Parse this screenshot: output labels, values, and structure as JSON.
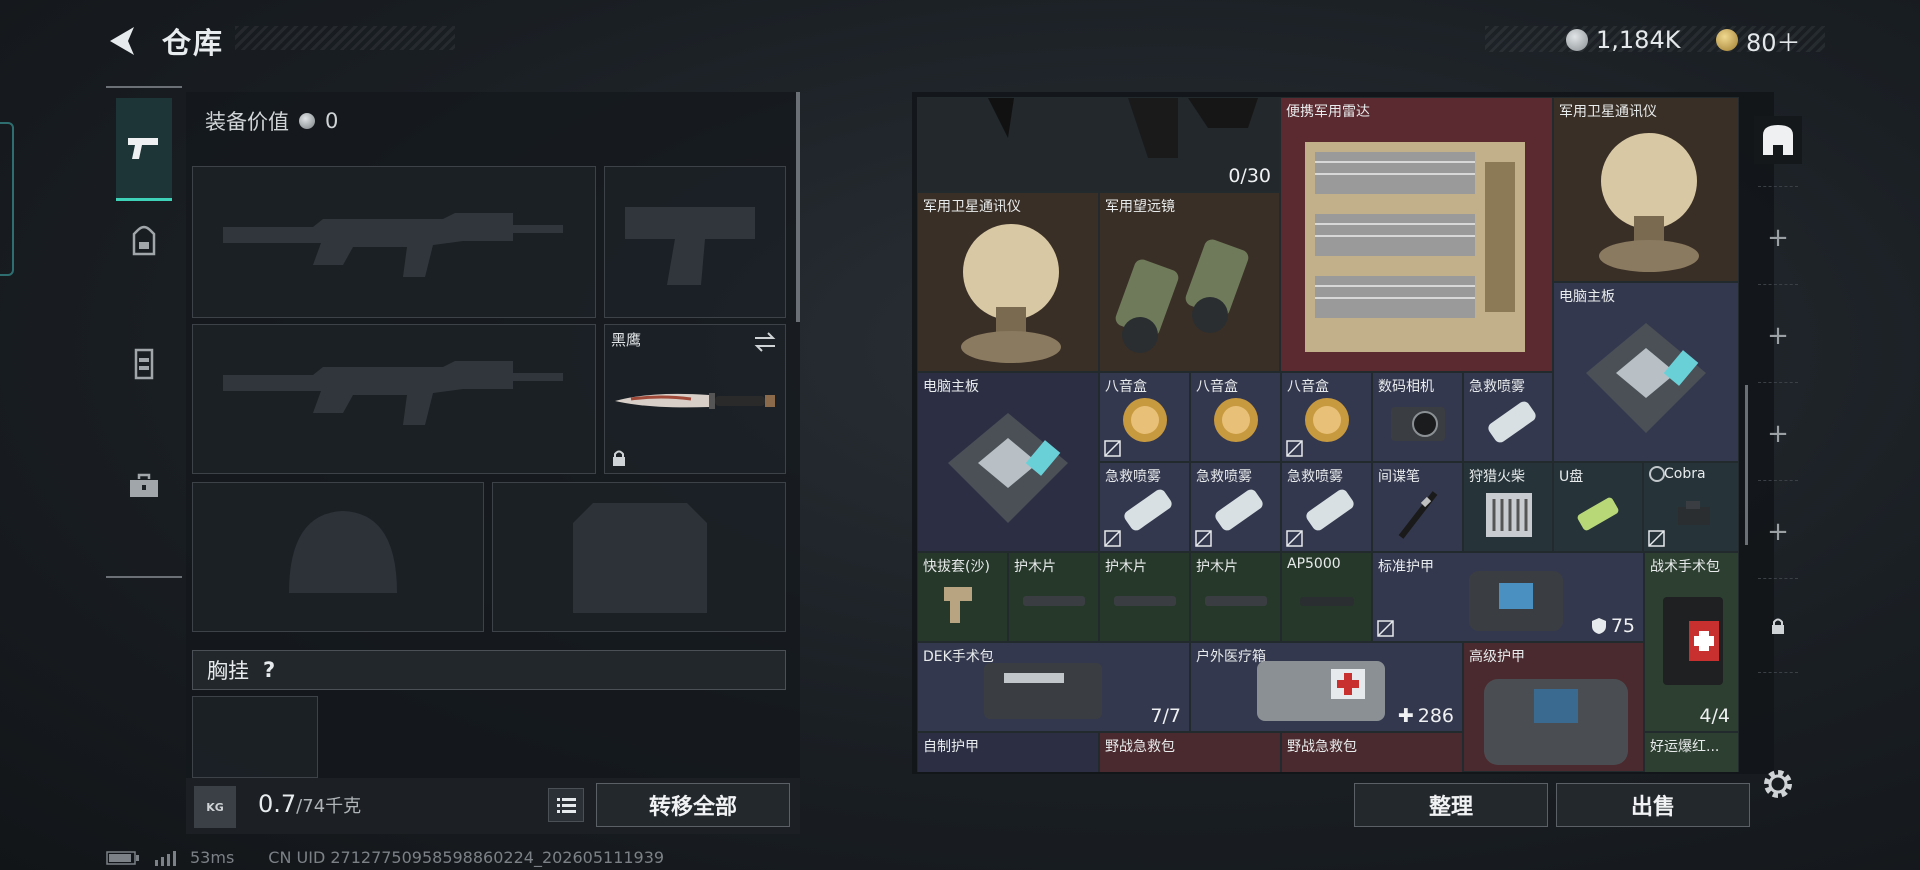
{
  "header": {
    "title": "仓库",
    "currency1": "1,184K",
    "currency2": "80＋"
  },
  "side_tabs": [
    {
      "icon": "pistol-icon",
      "active": true
    },
    {
      "icon": "backpack-icon",
      "active": false
    },
    {
      "icon": "vest-icon",
      "active": false
    },
    {
      "icon": "toolbox-icon",
      "active": false
    }
  ],
  "equipment": {
    "value_label": "装备价值",
    "value": "0",
    "melee_label": "黑鹰",
    "chest_label": "胸挂",
    "help": "?",
    "weight_current": "0.7",
    "weight_max": "/74千克",
    "kg_icon_text": "KG",
    "transfer_all": "转移全部"
  },
  "warehouse": {
    "cells": [
      {
        "name": "",
        "count": "0/30"
      },
      {
        "name": "便携军用雷达"
      },
      {
        "name": "军用卫星通讯仪"
      },
      {
        "name": "军用卫星通讯仪"
      },
      {
        "name": "军用望远镜"
      },
      {
        "name": "电脑主板"
      },
      {
        "name": "电脑主板"
      },
      {
        "name": "八音盒"
      },
      {
        "name": "八音盒"
      },
      {
        "name": "八音盒"
      },
      {
        "name": "数码相机"
      },
      {
        "name": "急救喷雾"
      },
      {
        "name": "急救喷雾"
      },
      {
        "name": "急救喷雾"
      },
      {
        "name": "急救喷雾"
      },
      {
        "name": "间谍笔"
      },
      {
        "name": "狩猎火柴"
      },
      {
        "name": "U盘"
      },
      {
        "name": "Cobra"
      },
      {
        "name": "快拔套(沙)"
      },
      {
        "name": "护木片"
      },
      {
        "name": "护木片"
      },
      {
        "name": "护木片"
      },
      {
        "name": "AP5000"
      },
      {
        "name": "标准护甲",
        "count": "75"
      },
      {
        "name": "战术手术包",
        "count": "4/4"
      },
      {
        "name": "DEK手术包",
        "count": "7/7"
      },
      {
        "name": "户外医疗箱",
        "count": "286"
      },
      {
        "name": "高级护甲"
      },
      {
        "name": "自制护甲"
      },
      {
        "name": "野战急救包"
      },
      {
        "name": "野战急救包"
      },
      {
        "name": "好运爆红..."
      }
    ],
    "sort_button": "整理",
    "sell_button": "出售"
  },
  "footer": {
    "ping": "53ms",
    "uid": "CN UID 27127750958598860224_202605111939"
  },
  "colors": {
    "accent": "#3ed2b8",
    "red_cell": "#5a2a30",
    "blue_cell": "#2c2f44",
    "green_cell": "#26382a"
  }
}
